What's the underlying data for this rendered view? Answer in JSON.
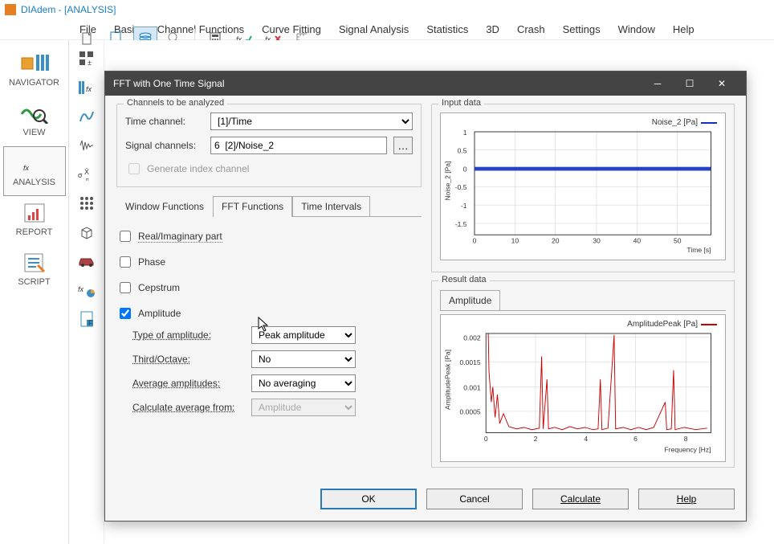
{
  "app": {
    "title": "DIAdem - [ANALYSIS]"
  },
  "menu": [
    "File",
    "Basic",
    "Channel Functions",
    "Curve Fitting",
    "Signal Analysis",
    "Statistics",
    "3D",
    "Crash",
    "Settings",
    "Window",
    "Help"
  ],
  "leftnav": [
    {
      "label": "NAVIGATOR"
    },
    {
      "label": "VIEW"
    },
    {
      "label": "ANALYSIS"
    },
    {
      "label": "REPORT"
    },
    {
      "label": "SCRIPT"
    }
  ],
  "dialog": {
    "title": "FFT with One Time Signal",
    "channels_group": "Channels to be analyzed",
    "time_channel_label": "Time channel:",
    "time_channel_value": "[1]/Time",
    "signal_channels_label": "Signal channels:",
    "signal_channels_value": "6  [2]/Noise_2",
    "gen_index_label": "Generate index channel",
    "tabs": [
      "Window Functions",
      "FFT Functions",
      "Time Intervals"
    ],
    "chk_real": "Real/Imaginary part",
    "chk_phase": "Phase",
    "chk_cepstrum": "Cepstrum",
    "chk_amplitude": "Amplitude",
    "type_amp_label": "Type of amplitude:",
    "type_amp_value": "Peak amplitude",
    "third_oct_label": "Third/Octave:",
    "third_oct_value": "No",
    "avg_amp_label": "Average amplitudes:",
    "avg_amp_value": "No averaging",
    "calc_avg_label": "Calculate average from:",
    "calc_avg_value": "Amplitude",
    "input_title": "Input data",
    "input_legend": "Noise_2 [Pa]",
    "input_ylabel": "Noise_2 [Pa]",
    "input_xlabel": "Time [s]",
    "result_title": "Result data",
    "result_tab": "Amplitude",
    "result_legend": "AmplitudePeak [Pa]",
    "result_ylabel": "AmplitudePeak [Pa]",
    "result_xlabel": "Frequency [Hz]",
    "btn_ok": "OK",
    "btn_cancel": "Cancel",
    "btn_calc": "Calculate",
    "btn_help": "Help"
  },
  "chart_data": [
    {
      "type": "line",
      "title": "Input data",
      "xlabel": "Time [s]",
      "ylabel": "Noise_2 [Pa]",
      "xlim": [
        0,
        58
      ],
      "ylim": [
        -1.5,
        1.5
      ],
      "xticks": [
        0,
        10,
        20,
        30,
        40,
        50
      ],
      "yticks": [
        -1.5,
        -1,
        -0.5,
        0,
        0.5,
        1
      ],
      "series": [
        {
          "name": "Noise_2 [Pa]",
          "color": "#1030c0",
          "note": "dense noise signal oscillating near 0"
        }
      ]
    },
    {
      "type": "line",
      "title": "Result data - Amplitude",
      "xlabel": "Frequency [Hz]",
      "ylabel": "AmplitudePeak [Pa]",
      "xlim": [
        0,
        9
      ],
      "ylim": [
        0,
        0.0022
      ],
      "xticks": [
        0,
        2,
        4,
        6,
        8
      ],
      "yticks": [
        0.0005,
        0.001,
        0.0015,
        0.002
      ],
      "series": [
        {
          "name": "AmplitudePeak [Pa]",
          "color": "#cc0000",
          "peaks_x": [
            0.1,
            0.3,
            0.6,
            2.3,
            2.5,
            4.6,
            5.2,
            7.3,
            7.5
          ],
          "peaks_y": [
            0.0022,
            0.0012,
            0.0008,
            0.0016,
            0.0011,
            0.0012,
            0.0021,
            0.0007,
            0.0013
          ]
        }
      ]
    }
  ]
}
